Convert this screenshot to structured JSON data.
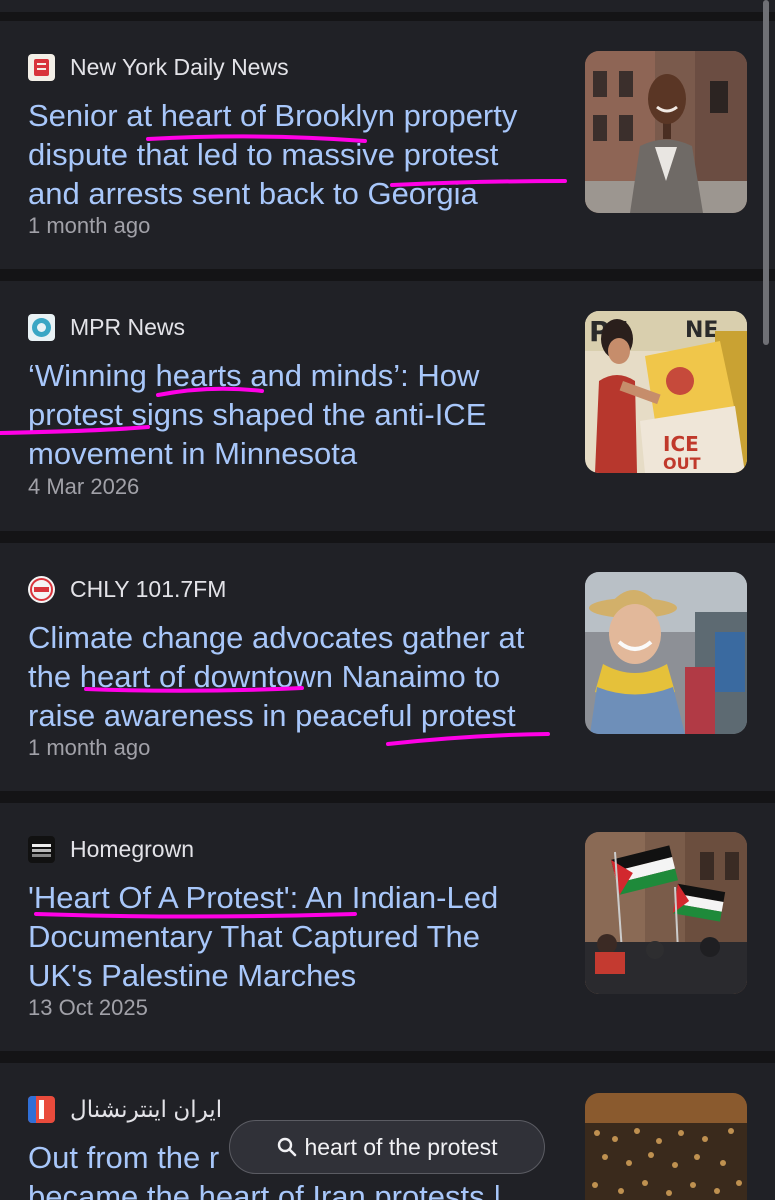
{
  "accent": {
    "link": "#a8c7fa",
    "highlight": "#ff00e6"
  },
  "articles": [
    {
      "source": "New York Daily News",
      "favicon": "nydn-icon",
      "headline_lines": [
        "Senior at heart of Brooklyn property",
        "dispute that led to massive protest",
        "and arrests sent back to Georgia"
      ],
      "time": "1 month ago"
    },
    {
      "source": "MPR News",
      "favicon": "mpr-icon",
      "headline_lines": [
        "‘Winning hearts and minds’: How",
        "protest signs shaped the anti-ICE",
        "movement in Minnesota"
      ],
      "time": "4 Mar 2026"
    },
    {
      "source": "CHLY 101.7FM",
      "favicon": "chly-icon",
      "headline_lines": [
        "Climate change advocates gather at",
        "the heart of downtown Nanaimo to",
        "raise awareness in peaceful protest"
      ],
      "time": "1 month ago"
    },
    {
      "source": "Homegrown",
      "favicon": "homegrown-icon",
      "headline_lines": [
        "'Heart Of A Protest': An Indian-Led",
        "Documentary That Captured The",
        "UK's Palestine Marches"
      ],
      "time": "13 Oct 2025"
    },
    {
      "source": "ایران اینترنشنال",
      "favicon": "iran-international-icon",
      "headline_lines": [
        "Out from the r",
        "became the heart of Iran protests |"
      ],
      "time": ""
    }
  ],
  "search_chip": {
    "query": "heart of the protest",
    "icon": "search-icon"
  }
}
